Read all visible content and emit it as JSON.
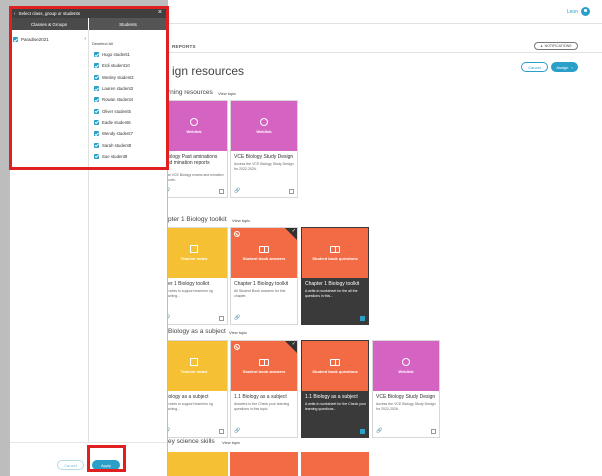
{
  "topbar": {
    "user_name": "Leon"
  },
  "main": {
    "tab_reports": "REPORTS",
    "notifications_label": "NOTIFICATIONS",
    "title": "ign resources",
    "cancel_label": "Cancel",
    "assign_label": "Assign"
  },
  "sections": [
    {
      "title": "rning resources",
      "view": "View topic"
    },
    {
      "title": "pter 1 Biology toolkit",
      "view": "View topic"
    },
    {
      "title": "Biology as a subject",
      "view": "View topic"
    },
    {
      "title": "ey science skills",
      "view": "View topic"
    }
  ],
  "cards": {
    "c1": {
      "thumb": "Weblink",
      "title": "Biology Past aminations and mination reports",
      "desc": "past VCE Biology exams and mination reports."
    },
    "c2": {
      "thumb": "Weblink",
      "title": "VCE Biology Study Design",
      "desc": "Access the VCE Biology Study Design for 2022-2026."
    },
    "c3": {
      "thumb": "Teacher notes",
      "title": "pter 1 Biology toolkit",
      "desc": "all notes to support teachers ng teaching..."
    },
    "c4": {
      "thumb": "Student book answers",
      "title": "Chapter 1 Biology toolkit",
      "desc": "All Student Book answers for this chapter."
    },
    "c5": {
      "thumb": "Student book questions",
      "title": "Chapter 1 Biology toolkit",
      "desc": "A write-in worksheet for the all the questions in this..."
    },
    "c6": {
      "thumb": "Teacher notes",
      "title": "Biology as a subject",
      "desc": "all notes to support teachers ng teaching..."
    },
    "c7": {
      "thumb": "Student book answers",
      "title": "1.1 Biology as a subject",
      "desc": "Answers to the Check your learning questions in this topic."
    },
    "c8": {
      "thumb": "Student book questions",
      "title": "1.1 Biology as a subject",
      "desc": "A write-in worksheet for the Check your learning questions..."
    },
    "c9": {
      "thumb": "Weblink",
      "title": "VCE Biology Study Design",
      "desc": "Access the VCE Biology Study Design for 2022-2026."
    }
  },
  "modal": {
    "header": "Select class, group or students",
    "col_classes": "Classes & Groups",
    "col_students": "Students",
    "class_name": "Paradise2021",
    "deselect_all": "Deselect All",
    "students": [
      "Hugo student1",
      "Erdi student10",
      "Wesley student2",
      "Lauren student3",
      "Rowan student4",
      "Oliver student5",
      "Eadie student6",
      "Wendy student7",
      "Sarah student8",
      "Sue student9"
    ],
    "cancel_label": "Cancel",
    "apply_label": "Apply"
  }
}
